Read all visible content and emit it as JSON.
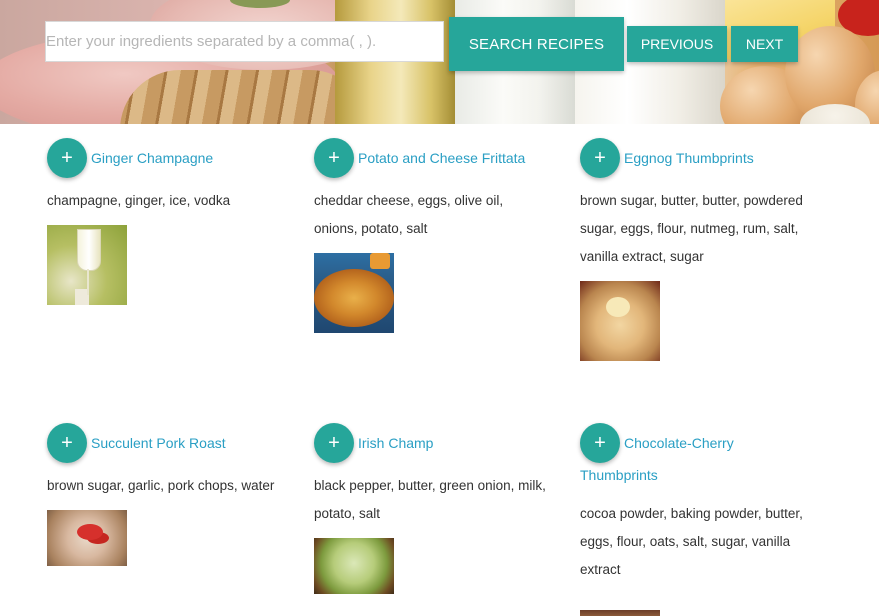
{
  "search": {
    "placeholder": "Enter your ingredients separated by a comma( , ).",
    "value": "",
    "button_label": "SEARCH RECIPES"
  },
  "pagination": {
    "previous_label": "PREVIOUS",
    "next_label": "NEXT"
  },
  "recipe_add_icon": "+",
  "recipes": [
    {
      "title": "Ginger Champagne",
      "ingredients": "champagne, ginger, ice, vodka"
    },
    {
      "title": "Potato and Cheese Frittata",
      "ingredients": "cheddar cheese, eggs, olive oil, onions, potato, salt"
    },
    {
      "title": "Eggnog Thumbprints",
      "ingredients": "brown sugar, butter, butter, powdered sugar, eggs, flour, nutmeg, rum, salt, vanilla extract, sugar"
    },
    {
      "title": "Succulent Pork Roast",
      "ingredients": "brown sugar, garlic, pork chops, water"
    },
    {
      "title": "Irish Champ",
      "ingredients": "black pepper, butter, green onion, milk, potato, salt"
    },
    {
      "title": "Chocolate-Cherry Thumbprints",
      "ingredients": "cocoa powder, baking powder, butter, eggs, flour, oats, salt, sugar, vanilla extract"
    }
  ],
  "colors": {
    "accent": "#26a69a",
    "link": "#2a9fc4",
    "text": "#333333"
  }
}
